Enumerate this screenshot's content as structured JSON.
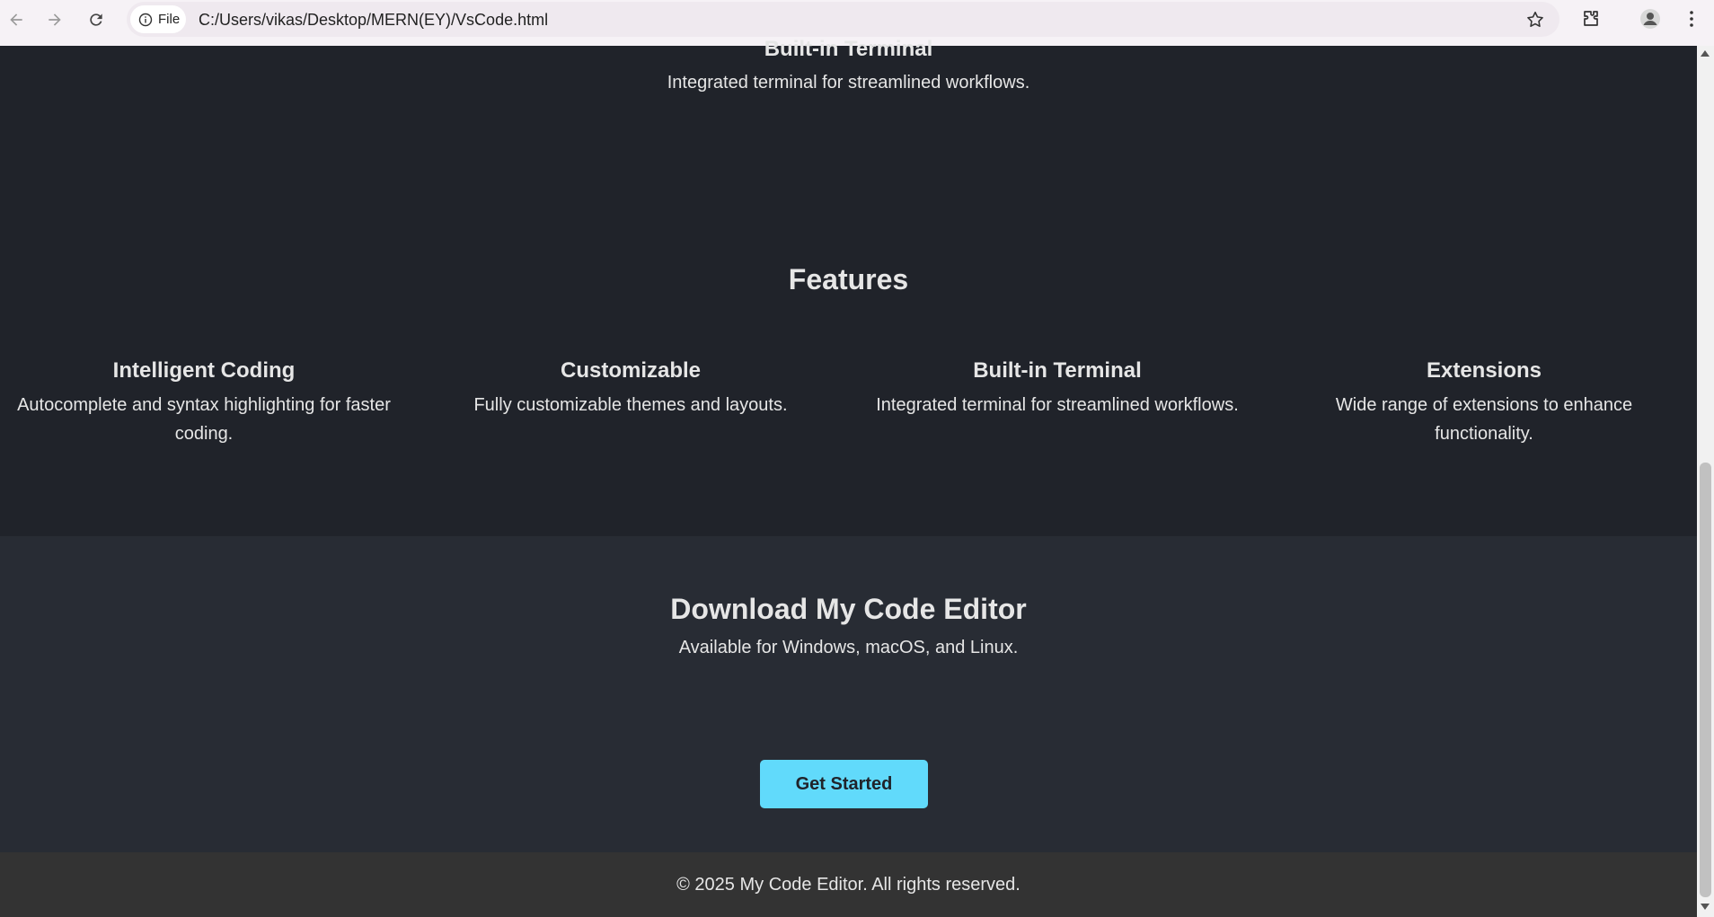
{
  "browser": {
    "back_icon": "arrow-left-icon",
    "forward_icon": "arrow-right-icon",
    "reload_icon": "reload-icon",
    "site_info_label": "File",
    "url": "C:/Users/vikas/Desktop/MERN(EY)/VsCode.html"
  },
  "page": {
    "partial_feature": {
      "title": "Built-in Terminal",
      "text": "Integrated terminal for streamlined workflows."
    },
    "features_title": "Features",
    "features": [
      {
        "title": "Intelligent Coding",
        "text": "Autocomplete and syntax highlighting for faster coding."
      },
      {
        "title": "Customizable",
        "text": "Fully customizable themes and layouts."
      },
      {
        "title": "Built-in Terminal",
        "text": "Integrated terminal for streamlined workflows."
      },
      {
        "title": "Extensions",
        "text": "Wide range of extensions to enhance functionality."
      }
    ],
    "download": {
      "title": "Download My Code Editor",
      "subtitle": "Available for Windows, macOS, and Linux.",
      "button_label": "Get Started"
    },
    "footer": "© 2025 My Code Editor. All rights reserved."
  },
  "colors": {
    "page_bg": "#20232a",
    "download_bg": "#282c34",
    "footer_bg": "#333333",
    "accent": "#61dafb",
    "text": "#e6e6e6"
  }
}
